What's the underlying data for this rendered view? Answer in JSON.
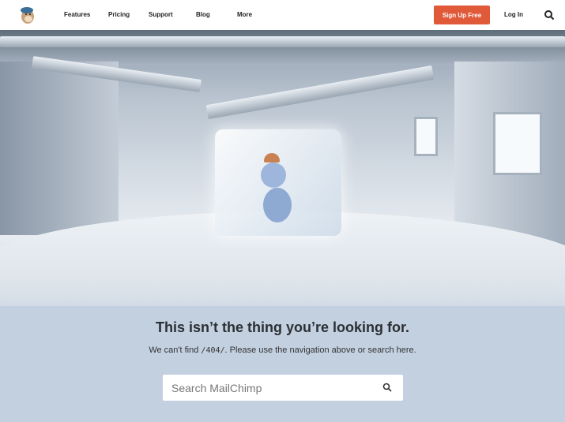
{
  "nav": {
    "items": [
      "Features",
      "Pricing",
      "Support",
      "Blog",
      "More"
    ],
    "signup": "Sign Up Free",
    "login": "Log In"
  },
  "main": {
    "title": "This isn’t the thing you’re looking for.",
    "sub_before": "We can't find ",
    "path": "/404/",
    "sub_after": ". Please use the navigation above or search here.",
    "search_placeholder": "Search MailChimp"
  },
  "colors": {
    "accent": "#e05a3a",
    "background": "#c3d0e0"
  }
}
